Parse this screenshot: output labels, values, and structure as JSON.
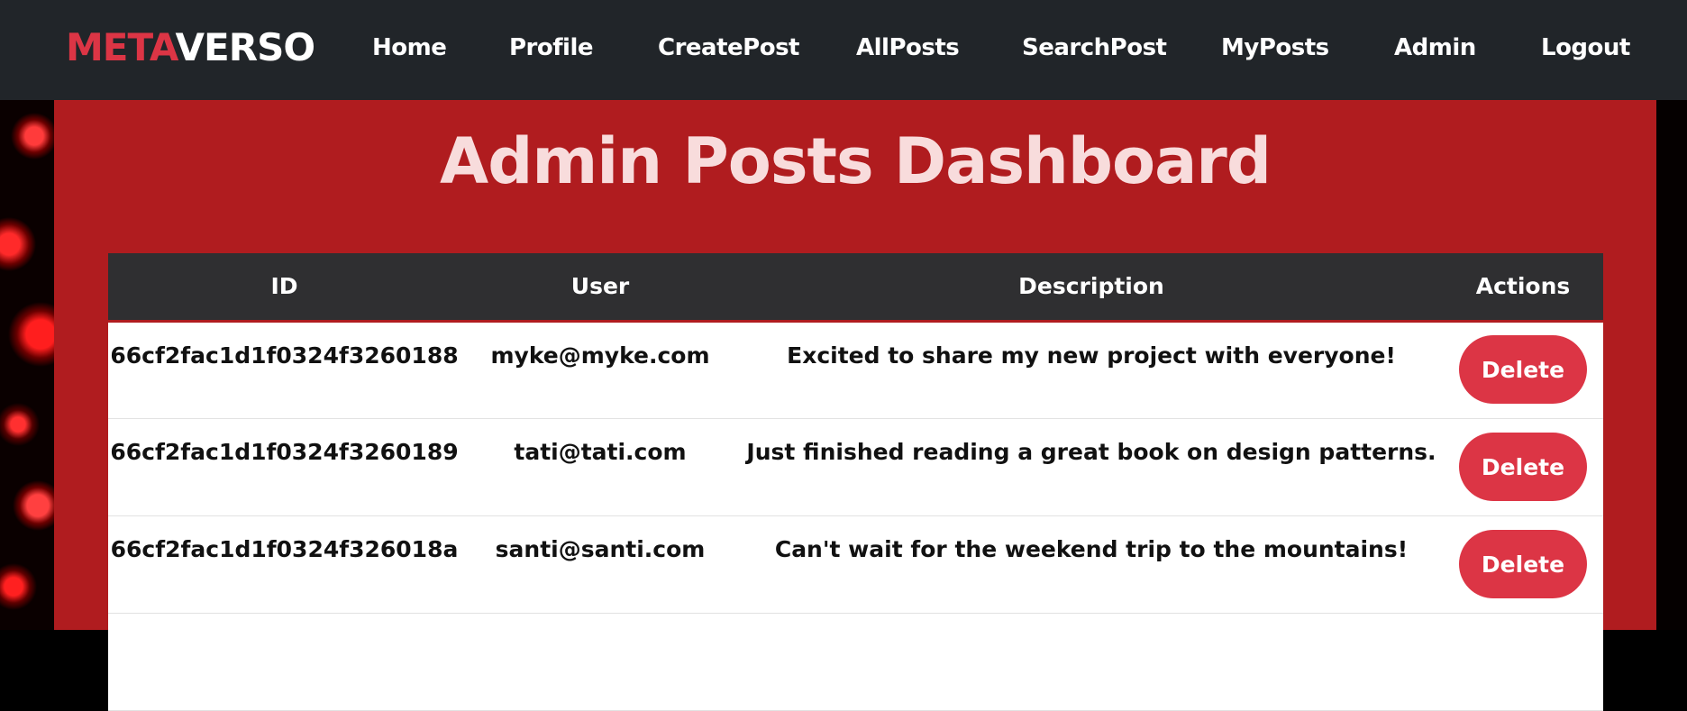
{
  "navbar": {
    "brand_part1": "META",
    "brand_part2": "VERSO",
    "links": [
      "Home",
      "Profile",
      "CreatePost",
      "AllPosts",
      "SearchPost",
      "MyPosts",
      "Admin",
      "Logout"
    ]
  },
  "page": {
    "title": "Admin Posts Dashboard"
  },
  "table": {
    "headers": [
      "ID",
      "User",
      "Description",
      "Actions"
    ],
    "rows": [
      {
        "id": "66cf2fac1d1f0324f3260188",
        "user": "myke@myke.com",
        "description": "Excited to share my new project with everyone!",
        "action": "Delete"
      },
      {
        "id": "66cf2fac1d1f0324f3260189",
        "user": "tati@tati.com",
        "description": "Just finished reading a great book on design patterns.",
        "action": "Delete"
      },
      {
        "id": "66cf2fac1d1f0324f326018a",
        "user": "santi@santi.com",
        "description": "Can't wait for the weekend trip to the mountains!",
        "action": "Delete"
      }
    ]
  },
  "colors": {
    "navbar_bg": "#212529",
    "brand_accent": "#dc3545",
    "main_bg": "#b01c1f",
    "title_color": "#f8dcdc",
    "table_header_bg": "#2f2f31",
    "delete_button": "#dc3545"
  }
}
